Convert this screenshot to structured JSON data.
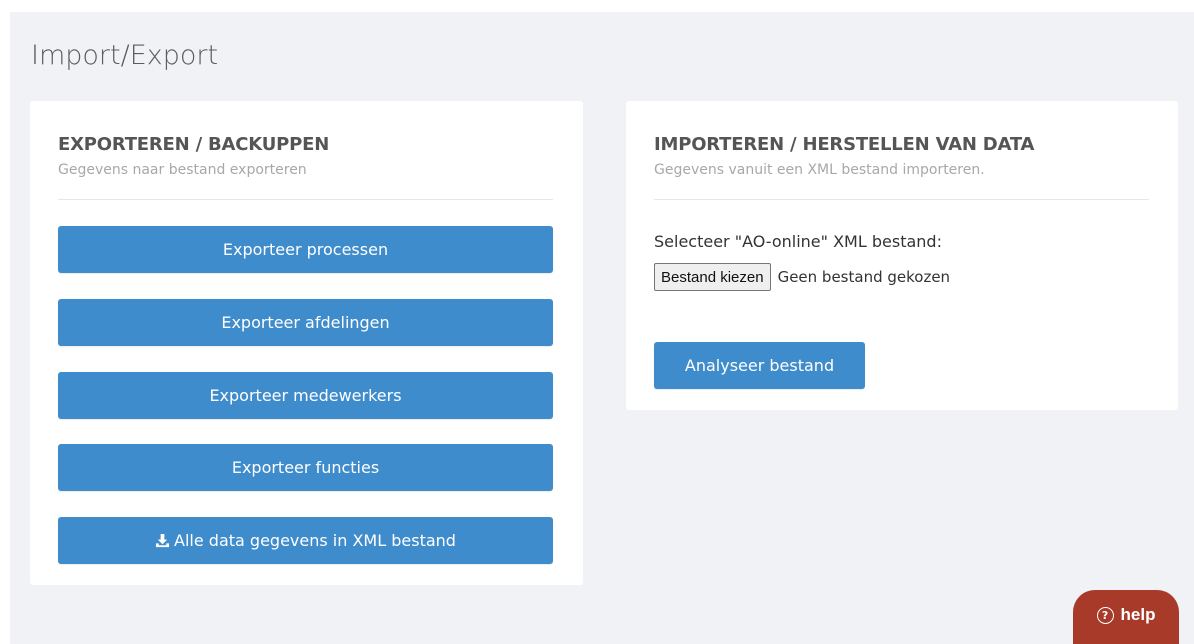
{
  "page": {
    "title": "Import/Export"
  },
  "export_panel": {
    "heading": "EXPORTEREN / BACKUPPEN",
    "subtitle": "Gegevens naar bestand exporteren",
    "buttons": [
      {
        "label": "Exporteer processen"
      },
      {
        "label": "Exporteer afdelingen"
      },
      {
        "label": "Exporteer medewerkers"
      },
      {
        "label": "Exporteer functies"
      },
      {
        "label": "Alle data gegevens in XML bestand",
        "icon": "download-icon"
      }
    ]
  },
  "import_panel": {
    "heading": "IMPORTEREN / HERSTELLEN VAN DATA",
    "subtitle": "Gegevens vanuit een XML bestand importeren.",
    "file_label": "Selecteer \"AO-online\" XML bestand:",
    "file_button_label": "Bestand kiezen",
    "file_status": "Geen bestand gekozen",
    "analyse_button_label": "Analyseer bestand"
  },
  "help": {
    "label": "help",
    "icon": "question-circle-icon",
    "icon_glyph": "?"
  },
  "colors": {
    "primary_button": "#3f8ccd",
    "help_button": "#a83a2a",
    "page_background": "#f0f2f5",
    "panel_background": "#ffffff"
  }
}
